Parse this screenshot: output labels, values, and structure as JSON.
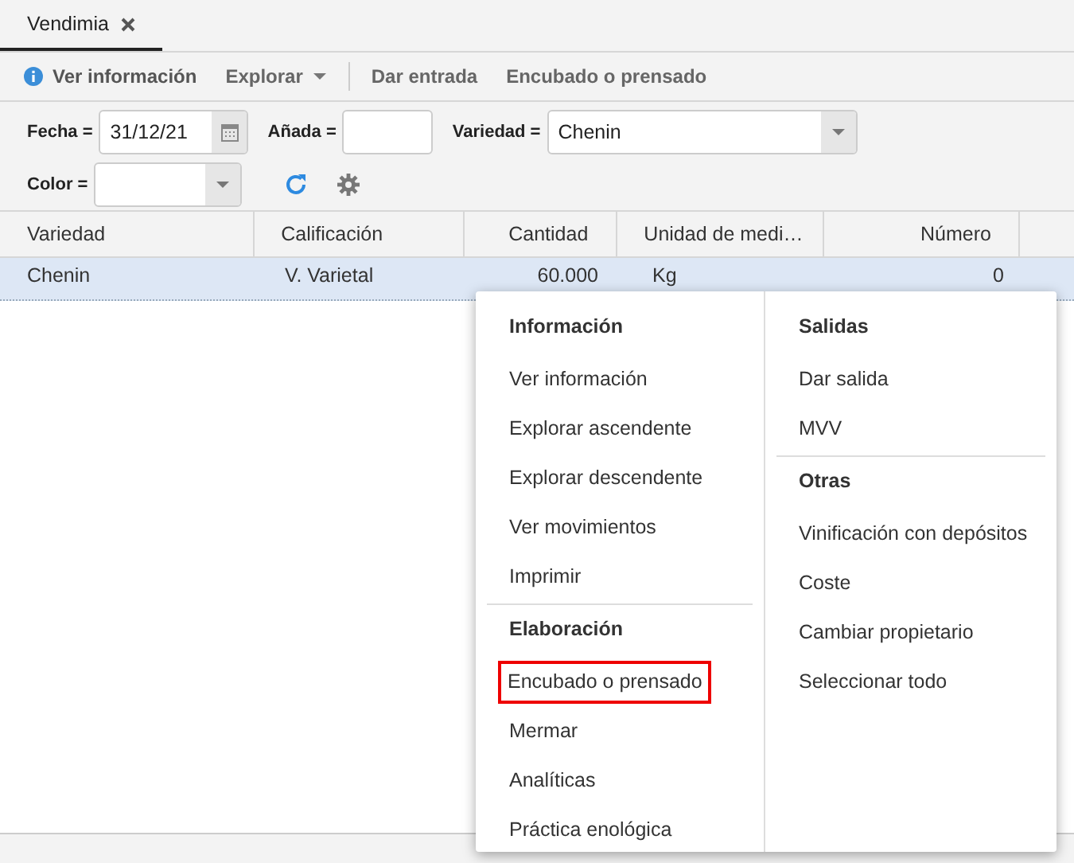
{
  "tabs": [
    {
      "label": "Vendimia",
      "selected": true
    }
  ],
  "toolbar": [
    {
      "kind": "info",
      "label": "Ver información"
    },
    {
      "kind": "dropdown",
      "label": "Explorar"
    },
    {
      "kind": "separator"
    },
    {
      "kind": "plain",
      "label": "Dar entrada"
    },
    {
      "kind": "plain",
      "label": "Encubado o prensado"
    }
  ],
  "filters": [
    {
      "kind": "date",
      "label": "Fecha =",
      "value": "31/12/21"
    },
    {
      "kind": "text",
      "label": "Añada ="
    },
    {
      "kind": "select",
      "label": "Variedad =",
      "value": "Chenin"
    },
    {
      "kind": "select",
      "label": "Color ="
    }
  ],
  "table": {
    "columns": [
      {
        "label": "Variedad"
      },
      {
        "label": "Calificación"
      },
      {
        "label": "Cantidad"
      },
      {
        "label": "Unidad de medi…"
      },
      {
        "label": "Número"
      }
    ],
    "rows": [
      {
        "selected": true,
        "cells": [
          "Chenin",
          "V. Varietal",
          "60.000",
          "Kg",
          "0"
        ]
      }
    ]
  },
  "context_menu": {
    "columns": [
      [
        {
          "kind": "header",
          "label": "Información"
        },
        {
          "kind": "item",
          "label": "Ver información",
          "highlighted": false
        },
        {
          "kind": "item",
          "label": "Explorar ascendente",
          "highlighted": false
        },
        {
          "kind": "item",
          "label": "Explorar descendente",
          "highlighted": false
        },
        {
          "kind": "item",
          "label": "Ver movimientos",
          "highlighted": false
        },
        {
          "kind": "item",
          "label": "Imprimir",
          "highlighted": false
        },
        {
          "kind": "separator"
        },
        {
          "kind": "header",
          "label": "Elaboración"
        },
        {
          "kind": "item",
          "label": "Encubado o prensado",
          "highlighted": true
        },
        {
          "kind": "item",
          "label": "Mermar",
          "highlighted": false
        },
        {
          "kind": "item",
          "label": "Analíticas",
          "highlighted": false
        },
        {
          "kind": "item",
          "label": "Práctica enológica",
          "highlighted": false
        }
      ],
      [
        {
          "kind": "header",
          "label": "Salidas"
        },
        {
          "kind": "item",
          "label": "Dar salida",
          "highlighted": false
        },
        {
          "kind": "item",
          "label": "MVV",
          "highlighted": false
        },
        {
          "kind": "separator"
        },
        {
          "kind": "header",
          "label": "Otras"
        },
        {
          "kind": "item",
          "label": "Vinificación con depósitos",
          "highlighted": false
        },
        {
          "kind": "item",
          "label": "Coste",
          "highlighted": false
        },
        {
          "kind": "item",
          "label": "Cambiar propietario",
          "highlighted": false
        },
        {
          "kind": "item",
          "label": "Seleccionar todo",
          "highlighted": false
        }
      ]
    ]
  }
}
